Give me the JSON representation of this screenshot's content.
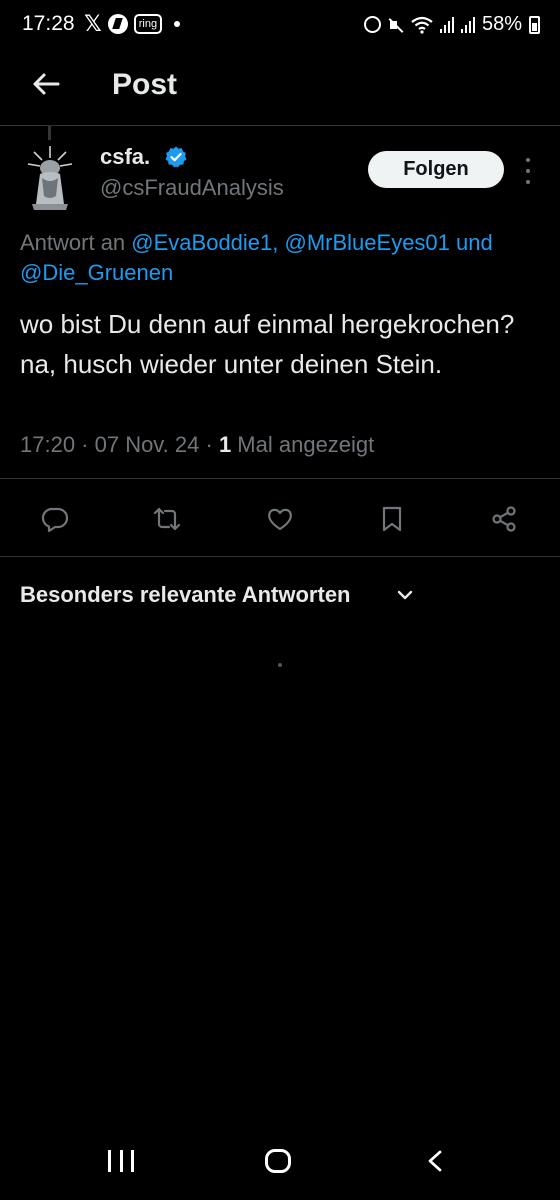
{
  "status_bar": {
    "time": "17:28",
    "ring_label": "ring",
    "battery": "58%"
  },
  "header": {
    "title": "Post"
  },
  "post": {
    "author_name": "csfa.",
    "author_handle": "@csFraudAnalysis",
    "follow_label": "Folgen",
    "reply_prefix": "Antwort an",
    "reply_mentions_line1": "@EvaBoddie1, @MrBlueEyes01 und",
    "reply_mentions_line2": "@Die_Gruenen",
    "text": "wo bist Du denn auf einmal hergekrochen? na, husch wieder unter deinen Stein.",
    "timestamp": "17:20 · 07 Nov. 24 · ",
    "view_count": "1",
    "view_label": " Mal angezeigt"
  },
  "replies": {
    "sort_label": "Besonders relevante Antworten"
  },
  "colors": {
    "background": "#000000",
    "text_primary": "#e7e9ea",
    "text_secondary": "#71767b",
    "accent": "#1d9bf0",
    "border": "#2f3336"
  },
  "icons": [
    "back-arrow-icon",
    "verified-icon",
    "more-icon",
    "reply-icon",
    "repost-icon",
    "like-icon",
    "bookmark-icon",
    "share-icon",
    "chevron-down-icon"
  ]
}
